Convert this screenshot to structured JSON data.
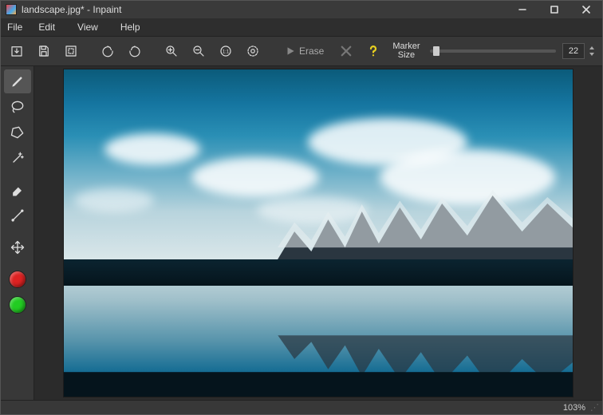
{
  "titlebar": {
    "title": "landscape.jpg* - Inpaint"
  },
  "menu": {
    "file": "File",
    "edit": "Edit",
    "view": "View",
    "help": "Help"
  },
  "toolbar": {
    "erase_label": "Erase",
    "marker_label_1": "Marker",
    "marker_label_2": "Size",
    "marker_value": "22",
    "slider_min": 1,
    "slider_max": 100,
    "slider_value": 22
  },
  "icons": {
    "open": "open-file-icon",
    "save": "save-icon",
    "selection": "selection-icon",
    "undo": "undo-icon",
    "redo": "redo-icon",
    "zoom_in": "zoom-in-icon",
    "zoom_out": "zoom-out-icon",
    "zoom_actual": "zoom-actual-icon",
    "zoom_fit": "zoom-fit-icon",
    "erase_play": "play-icon",
    "cancel": "x-icon",
    "help": "question-icon"
  },
  "tools": {
    "marker": "marker-tool-icon",
    "lasso": "lasso-tool-icon",
    "polygon": "polygon-tool-icon",
    "magic": "magic-wand-icon",
    "eraser": "eraser-tool-icon",
    "line": "line-tool-icon",
    "move": "move-tool-icon"
  },
  "colors": {
    "red": "#d22",
    "green": "#2c2"
  },
  "status": {
    "zoom": "103%"
  },
  "image": {
    "filename": "landscape.jpg",
    "description": "Coastal landscape with snow-capped mountain ridge on the right, blue sky with cumulus clouds, calm tidal pool reflecting sky and mountains in foreground"
  }
}
